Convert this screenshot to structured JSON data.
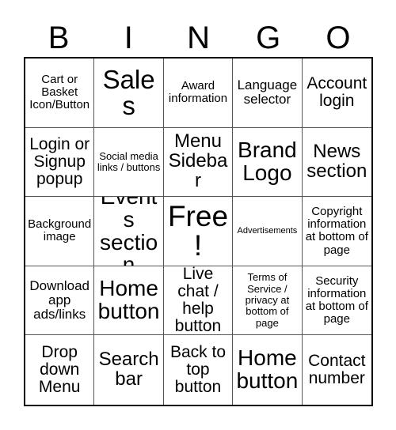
{
  "card": {
    "title": "BINGO",
    "header_letters": [
      "B",
      "I",
      "N",
      "G",
      "O"
    ],
    "columns": 5,
    "rows": 5,
    "free_space": "Free!",
    "free_space_position": "center",
    "colors": {
      "background": "#ffffff",
      "text": "#000000",
      "outer_border": "#000000",
      "grid_line": "#555555"
    }
  },
  "grid": [
    [
      {
        "text": "Cart or Basket Icon/Button",
        "size": "md"
      },
      {
        "text": "Sales",
        "size": "4xl"
      },
      {
        "text": "Award information",
        "size": "md"
      },
      {
        "text": "Language selector",
        "size": "lg"
      },
      {
        "text": "Account login",
        "size": "xl"
      }
    ],
    [
      {
        "text": "Login or Signup popup",
        "size": "xl"
      },
      {
        "text": "Social media links / buttons",
        "size": "sm"
      },
      {
        "text": "Menu Sidebar",
        "size": "2xl"
      },
      {
        "text": "Brand Logo",
        "size": "3xl"
      },
      {
        "text": "News section",
        "size": "2xl"
      }
    ],
    [
      {
        "text": "Background image",
        "size": "md"
      },
      {
        "text": "Events section",
        "size": "3xl"
      },
      {
        "text": "Free!",
        "size": "5xl"
      },
      {
        "text": "Advertisements",
        "size": "xs"
      },
      {
        "text": "Copyright information at bottom of page",
        "size": "md"
      }
    ],
    [
      {
        "text": "Download app ads/links",
        "size": "lg"
      },
      {
        "text": "Home button",
        "size": "3xl"
      },
      {
        "text": "Live chat / help button",
        "size": "xl"
      },
      {
        "text": "Terms of Service / privacy at bottom of page",
        "size": "sm"
      },
      {
        "text": "Security information at bottom of page",
        "size": "md"
      }
    ],
    [
      {
        "text": "Drop down Menu",
        "size": "xl"
      },
      {
        "text": "Search bar",
        "size": "2xl"
      },
      {
        "text": "Back to top button",
        "size": "xl"
      },
      {
        "text": "Home button",
        "size": "3xl"
      },
      {
        "text": "Contact number",
        "size": "xl"
      }
    ]
  ]
}
